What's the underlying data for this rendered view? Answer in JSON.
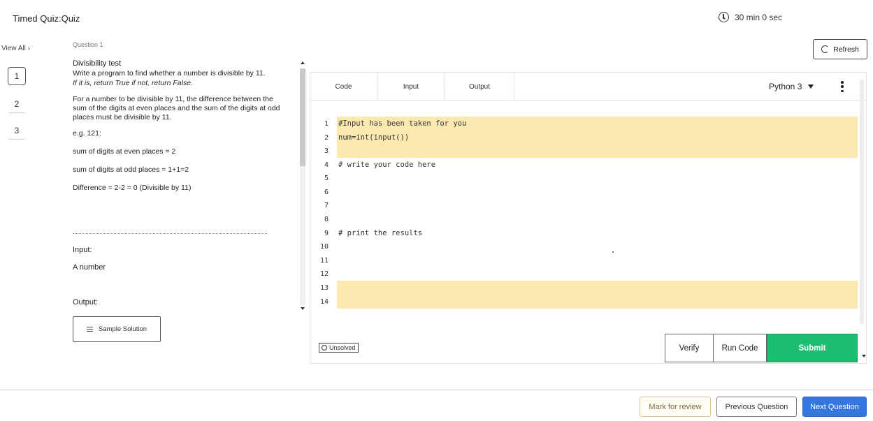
{
  "header": {
    "title": "Timed Quiz:Quiz",
    "timer": "30 min  0 sec"
  },
  "sidebar": {
    "view_all": "View All  ›",
    "questions": [
      "1",
      "2",
      "3"
    ],
    "active_question": "1"
  },
  "question": {
    "label": "Question 1",
    "title": "Divisibility test",
    "prompt_line1": "Write a program to find whether a number is divisible by 11.",
    "prompt_line2": "If it is, return True if not, return False.",
    "rule": "For a number to be divisible by 11, the difference between the sum of the digits at even places and the sum of the digits at odd places must be divisible by 11.",
    "example": "e.g. 121:",
    "even_sum": "sum of digits at even places = 2",
    "odd_sum": "sum of digits at odd places = 1+1=2",
    "difference": "Difference = 2-2 = 0 (Divisible by 11)",
    "input_label": "Input:",
    "input_value": "A number",
    "output_label": "Output:",
    "sample_solution_label": "Sample Solution"
  },
  "editor": {
    "tabs": [
      "Code",
      "Input",
      "Output"
    ],
    "language": "Python 3",
    "refresh_label": "Refresh",
    "lines": [
      {
        "num": "1",
        "text": "#Input has been taken for you"
      },
      {
        "num": "2",
        "text": "num=int(input())"
      },
      {
        "num": "3",
        "text": ""
      },
      {
        "num": "4",
        "text": "# write your code here"
      },
      {
        "num": "5",
        "text": ""
      },
      {
        "num": "6",
        "text": ""
      },
      {
        "num": "7",
        "text": ""
      },
      {
        "num": "8",
        "text": ""
      },
      {
        "num": "9",
        "text": "# print the results"
      },
      {
        "num": "10",
        "text": ""
      },
      {
        "num": "11",
        "text": ""
      },
      {
        "num": "12",
        "text": ""
      },
      {
        "num": "13",
        "text": ""
      },
      {
        "num": "14",
        "text": ""
      }
    ],
    "status": "Unsolved",
    "verify_label": "Verify",
    "run_label": "Run Code",
    "submit_label": "Submit",
    "colors": {
      "highlight": "#fbe9b0",
      "submit": "#1fbd72"
    }
  },
  "footer": {
    "mark_label": "Mark for review",
    "prev_label": "Previous Question",
    "next_label": "Next Question",
    "colors": {
      "next": "#3477e0"
    }
  }
}
